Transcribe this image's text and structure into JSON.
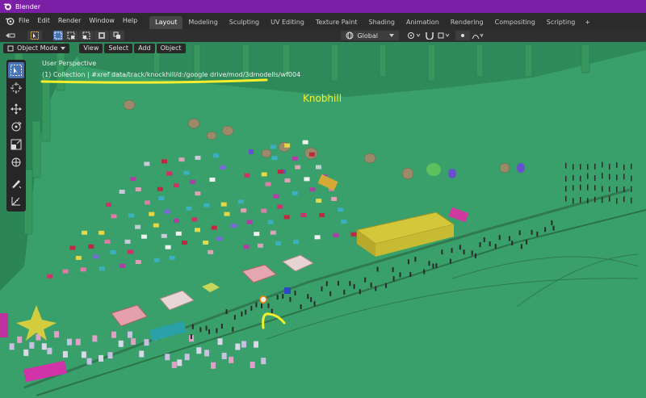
{
  "app": {
    "title": "Blender"
  },
  "menu": [
    "File",
    "Edit",
    "Render",
    "Window",
    "Help"
  ],
  "workspaces": [
    {
      "label": "Layout",
      "active": true
    },
    {
      "label": "Modeling",
      "active": false
    },
    {
      "label": "Sculpting",
      "active": false
    },
    {
      "label": "UV Editing",
      "active": false
    },
    {
      "label": "Texture Paint",
      "active": false
    },
    {
      "label": "Shading",
      "active": false
    },
    {
      "label": "Animation",
      "active": false
    },
    {
      "label": "Rendering",
      "active": false
    },
    {
      "label": "Compositing",
      "active": false
    },
    {
      "label": "Scripting",
      "active": false
    }
  ],
  "workspace_add": "+",
  "header": {
    "transform_orientation": "Global"
  },
  "viewport_header": {
    "mode": "Object Mode",
    "menus": [
      "View",
      "Select",
      "Add",
      "Object"
    ]
  },
  "viewport": {
    "perspective": "User Perspective",
    "collection_path": "(1) Collection | #xref data/track/knockhill/d:/google drive/mod/3dmodells/wf004",
    "annotation_label": "Knobhill"
  },
  "colors": {
    "ground": "#3aa06b",
    "title_bar": "#7b1fa6",
    "annotation": "#f4ef2c",
    "active_tool": "#4772b3"
  },
  "tools": [
    "select-box-icon",
    "cursor-icon",
    "move-icon",
    "rotate-icon",
    "scale-icon",
    "transform-icon",
    "annotate-icon",
    "measure-icon"
  ]
}
